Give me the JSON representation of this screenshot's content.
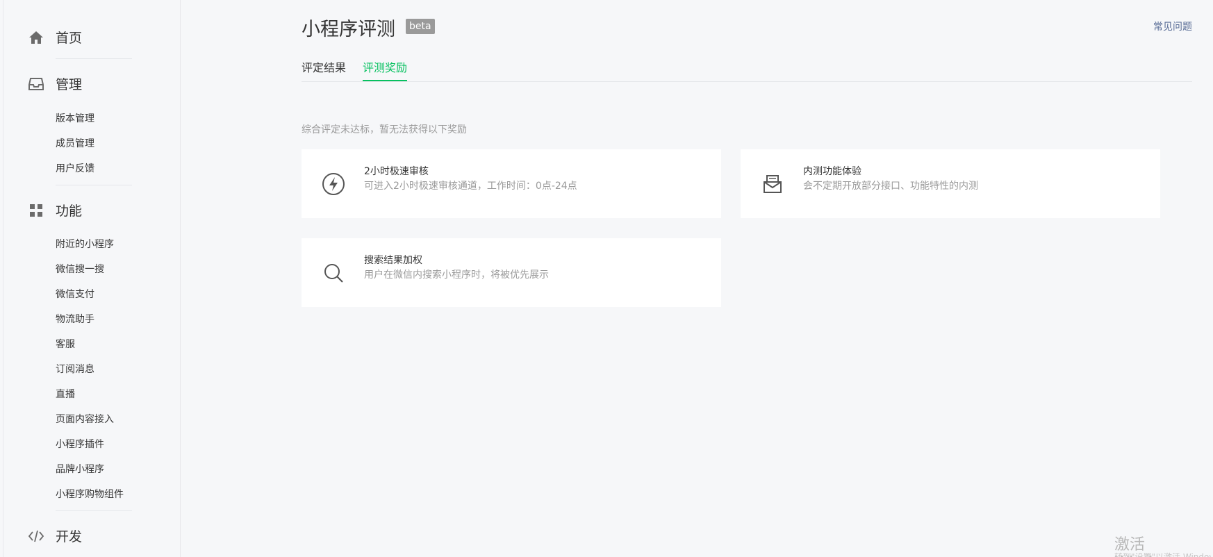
{
  "sidebar": {
    "sections": [
      {
        "label": "首页",
        "icon": "home-icon"
      },
      {
        "label": "管理",
        "icon": "inbox-icon"
      },
      {
        "label": "功能",
        "icon": "grid-icon"
      },
      {
        "label": "开发",
        "icon": "code-icon"
      }
    ],
    "management_items": [
      "版本管理",
      "成员管理",
      "用户反馈"
    ],
    "feature_items": [
      "附近的小程序",
      "微信搜一搜",
      "微信支付",
      "物流助手",
      "客服",
      "订阅消息",
      "直播",
      "页面内容接入",
      "小程序插件",
      "品牌小程序",
      "小程序购物组件"
    ]
  },
  "header": {
    "title": "小程序评测",
    "badge": "beta",
    "faq_link": "常见问题"
  },
  "tabs": [
    {
      "label": "评定结果",
      "active": false
    },
    {
      "label": "评测奖励",
      "active": true
    }
  ],
  "notice": "综合评定未达标，暂无法获得以下奖励",
  "rewards": [
    {
      "title": "2小时极速审核",
      "desc": "可进入2小时极速审核通道，工作时间：0点-24点",
      "icon": "lightning-icon"
    },
    {
      "title": "内测功能体验",
      "desc": "会不定期开放部分接口、功能特性的内测",
      "icon": "envelope-icon"
    },
    {
      "title": "搜索结果加权",
      "desc": "用户在微信内搜索小程序时，将被优先展示",
      "icon": "search-icon"
    }
  ],
  "watermark": {
    "title": "激活 Windows",
    "subtitle": "转到\"设置\"以激活 Windows。"
  },
  "colors": {
    "accent": "#07c160",
    "link": "#576b95",
    "badge_bg": "#9a9a9a",
    "muted_text": "#9a9a9a"
  }
}
